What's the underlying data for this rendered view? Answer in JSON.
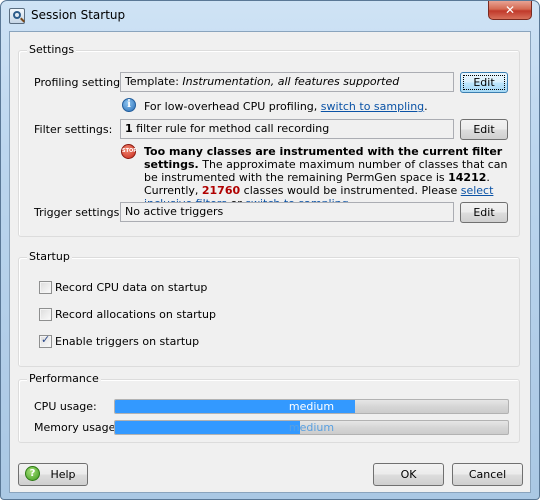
{
  "window": {
    "title": "Session Startup",
    "close_label": "✕",
    "icon": "session-startup-magnifier-icon"
  },
  "settings": {
    "group_title": "Settings",
    "profiling": {
      "label": "Profiling settings:",
      "value_prefix": "Template: ",
      "value_italic": "Instrumentation, all features supported",
      "edit_label": "Edit"
    },
    "info": {
      "icon": "info-icon",
      "text": "For low-overhead CPU profiling, ",
      "link": "switch to sampling",
      "suffix": "."
    },
    "filter": {
      "label": "Filter settings:",
      "value_bold": "1",
      "value_rest": " filter rule for method call recording",
      "edit_label": "Edit"
    },
    "warning": {
      "icon": "stop-icon",
      "icon_text": "STOP",
      "bold": "Too many classes are instrumented with the current filter settings.",
      "text1": " The approximate maximum number of classes that can be instrumented with the remaining PermGen space is ",
      "max_classes": "14212",
      "text2": ". Currently, ",
      "current_classes": "21760",
      "text3": " classes would be instrumented. Please ",
      "link1": "select inclusive filters",
      "text4": " or ",
      "link2": "switch to sampling",
      "text5": "."
    },
    "trigger": {
      "label": "Trigger settings:",
      "value": "No active triggers",
      "edit_label": "Edit"
    }
  },
  "startup": {
    "group_title": "Startup",
    "options": [
      {
        "label": "Record CPU data on startup",
        "checked": false
      },
      {
        "label": "Record allocations on startup",
        "checked": false
      },
      {
        "label": "Enable triggers on startup",
        "checked": true
      }
    ]
  },
  "performance": {
    "group_title": "Performance",
    "cpu": {
      "label": "CPU usage:",
      "level": "medium",
      "fill_percent": 61
    },
    "memory": {
      "label": "Memory usage:",
      "level": "medium",
      "fill_percent": 47
    }
  },
  "footer": {
    "help_label": "Help",
    "ok_label": "OK",
    "cancel_label": "Cancel"
  },
  "colors": {
    "progress_fill": "#3399ff",
    "link": "#0b53a6",
    "warning_number": "#b00000"
  }
}
